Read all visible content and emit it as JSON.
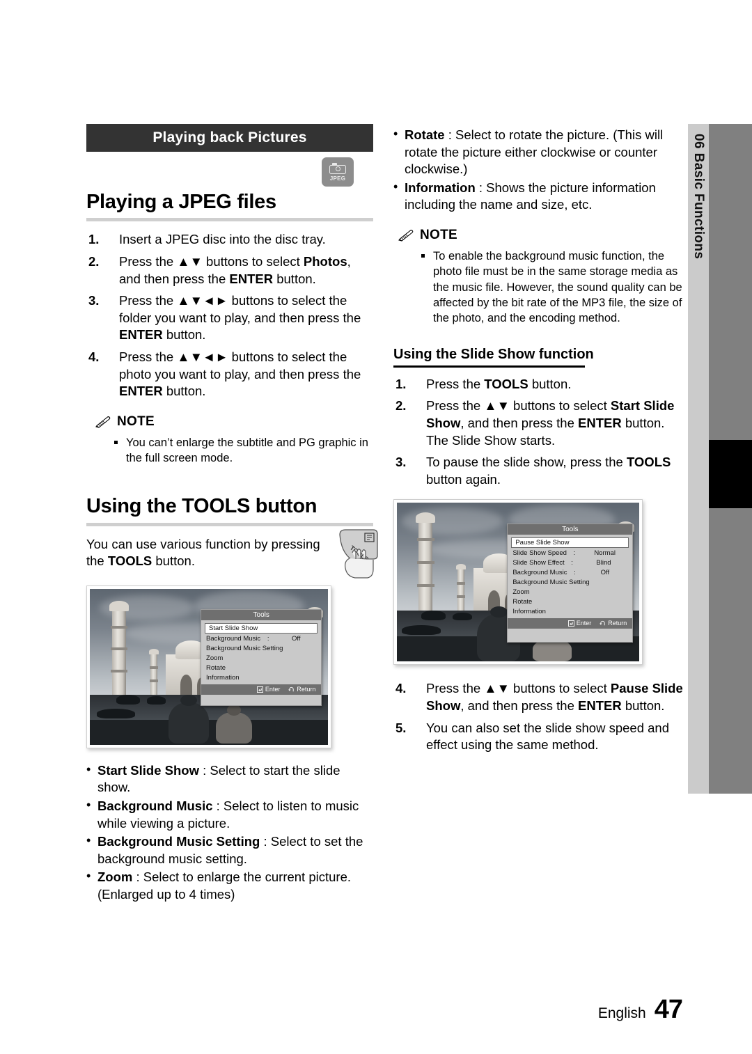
{
  "banner": {
    "title": "Playing back Pictures"
  },
  "badge": {
    "icon": "camera-icon",
    "label": "JPEG"
  },
  "left": {
    "heading": "Playing a JPEG files",
    "steps": [
      {
        "num": "1.",
        "html": "Insert a JPEG disc into the disc tray."
      },
      {
        "num": "2.",
        "html": "Press the ▲▼ buttons to select <b>Photos</b>, and then press the <b>ENTER</b> button."
      },
      {
        "num": "3.",
        "html": "Press the ▲▼◄► buttons to select the folder you want to play, and then press the <b>ENTER</b> button."
      },
      {
        "num": "4.",
        "html": "Press the ▲▼◄► buttons to select the photo you want to play, and then press the <b>ENTER</b> button."
      }
    ],
    "note": {
      "label": "NOTE",
      "items": [
        "You can’t enlarge the subtitle and PG graphic in the full screen mode."
      ]
    },
    "tools_heading": "Using the TOOLS button",
    "tools_intro": "You can use various function by pressing the <b>TOOLS</b> button.",
    "remote_label": "TOOLS",
    "defs": [
      {
        "html": "<b>Start Slide Show</b> : Select to start the slide show."
      },
      {
        "html": "<b>Background Music</b> : Select to listen to music while viewing a picture."
      },
      {
        "html": "<b>Background Music Setting</b> : Select to set the background music setting."
      },
      {
        "html": "<b>Zoom</b> : Select to enlarge the current picture. (Enlarged up to 4 times)"
      }
    ]
  },
  "right": {
    "defs": [
      {
        "html": "<b>Rotate</b> : Select to rotate the picture. (This will rotate the picture either clockwise or counter clockwise.)"
      },
      {
        "html": "<b>Information</b> : Shows the picture information including the name and size, etc."
      }
    ],
    "note": {
      "label": "NOTE",
      "items": [
        "To enable the background music function, the photo file must be in the same storage media as the music file. However, the sound quality can be affected by the bit rate of the MP3 file, the size of the photo, and the encoding method."
      ]
    },
    "slideshow_heading": "Using the Slide Show function",
    "steps": [
      {
        "num": "1.",
        "html": "Press the <b>TOOLS</b> button."
      },
      {
        "num": "2.",
        "html": "Press the ▲▼ buttons to select <b>Start Slide Show</b>, and then press the <b>ENTER</b> button. The Slide Show starts."
      },
      {
        "num": "3.",
        "html": "To pause the slide show, press the <b>TOOLS</b> button again."
      },
      {
        "num": "4.",
        "html": "Press the ▲▼ buttons to select <b>Pause Slide Show</b>, and then press the <b>ENTER</b> button."
      },
      {
        "num": "5.",
        "html": "You can also set the slide show speed and effect using the same method."
      }
    ]
  },
  "osd_left": {
    "title": "Tools",
    "rows": [
      {
        "label": "Start Slide Show",
        "colon": "",
        "value": "",
        "selected": true
      },
      {
        "label": "Background Music",
        "colon": ":",
        "value": "Off",
        "selected": false
      },
      {
        "label": "Background Music Setting",
        "colon": "",
        "value": "",
        "selected": false
      },
      {
        "label": "Zoom",
        "colon": "",
        "value": "",
        "selected": false
      },
      {
        "label": "Rotate",
        "colon": "",
        "value": "",
        "selected": false
      },
      {
        "label": "Information",
        "colon": "",
        "value": "",
        "selected": false
      }
    ],
    "footer": {
      "enter": "Enter",
      "return": "Return"
    }
  },
  "osd_right": {
    "title": "Tools",
    "rows": [
      {
        "label": "Pause Slide Show",
        "colon": "",
        "value": "",
        "selected": true
      },
      {
        "label": "Slide Show Speed",
        "colon": ":",
        "value": "Normal",
        "selected": false
      },
      {
        "label": "Slide Show Effect",
        "colon": ":",
        "value": "Blind",
        "selected": false
      },
      {
        "label": "Background Music",
        "colon": ":",
        "value": "Off",
        "selected": false
      },
      {
        "label": "Background Music Setting",
        "colon": "",
        "value": "",
        "selected": false
      },
      {
        "label": "Zoom",
        "colon": "",
        "value": "",
        "selected": false
      },
      {
        "label": "Rotate",
        "colon": "",
        "value": "",
        "selected": false
      },
      {
        "label": "Information",
        "colon": "",
        "value": "",
        "selected": false
      }
    ],
    "footer": {
      "enter": "Enter",
      "return": "Return"
    }
  },
  "sidetab": {
    "number": "06",
    "title": "Basic Functions",
    "label": "06  Basic Functions"
  },
  "footer": {
    "language": "English",
    "page": "47"
  },
  "colors": {
    "banner_bg": "#333333",
    "rule": "#cfcfcf",
    "sidetab_bg": "#cbcbcb",
    "sidebar_dark": "#808080",
    "sidebar_black": "#000000",
    "badge_bg": "#8d8d8d",
    "osd_bg": "#c9c9c9",
    "osd_bar": "#6f6f6f"
  }
}
